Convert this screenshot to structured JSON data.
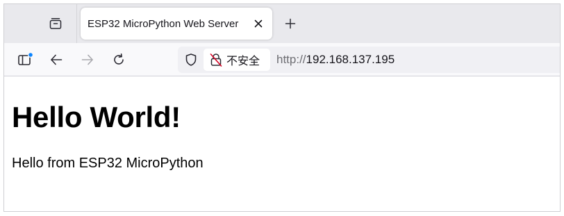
{
  "tabstrip": {
    "tab_groups_icon": "tab-groups-icon",
    "tabs": [
      {
        "title": "ESP32 MicroPython Web Server",
        "active": true,
        "close_icon": "close-icon"
      }
    ],
    "new_tab_icon": "plus-icon"
  },
  "navbar": {
    "sidebar_icon": "sidebar-icon",
    "back_icon": "arrow-left-icon",
    "forward_icon": "arrow-right-icon",
    "reload_icon": "reload-icon",
    "forward_enabled": false,
    "urlbar": {
      "shield_icon": "shield-icon",
      "security_icon": "broken-lock-icon",
      "security_label": "不安全",
      "url_scheme": "http://",
      "url_host": "192.168.137.195"
    }
  },
  "page": {
    "heading": "Hello World!",
    "paragraph": "Hello from ESP32 MicroPython"
  },
  "colors": {
    "tabstrip_bg": "#e9e9ed",
    "navbar_bg": "#f9f9fb",
    "urlbar_bg": "#f0f0f4",
    "sidebar_badge": "#0a84ff",
    "broken_lock": "#d70022",
    "text": "#15141a"
  }
}
